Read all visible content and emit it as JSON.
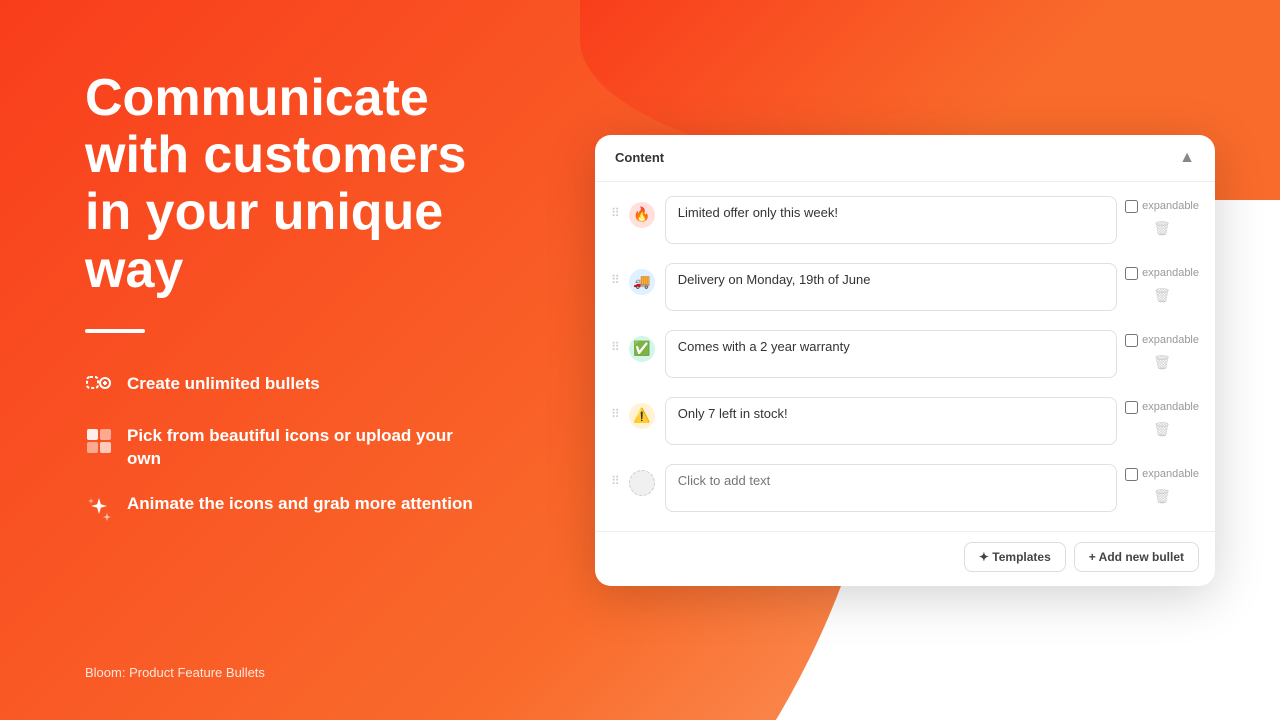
{
  "background": {
    "gradient_start": "#f93d1c",
    "gradient_end": "#fbae7a"
  },
  "left": {
    "headline": "Communicate with customers in your unique way",
    "divider": true,
    "features": [
      {
        "id": "unlimited-bullets",
        "text": "Create unlimited bullets",
        "icon": "bullets-icon"
      },
      {
        "id": "icons",
        "text": "Pick from beautiful icons or upload your own",
        "icon": "icons-icon"
      },
      {
        "id": "animate",
        "text": "Animate the icons and grab more attention",
        "icon": "animate-icon"
      }
    ],
    "brand": "Bloom: Product Feature Bullets"
  },
  "card": {
    "header": {
      "title": "Content",
      "collapse_label": "▲"
    },
    "bullets": [
      {
        "id": "bullet-1",
        "icon_type": "red",
        "icon_emoji": "🔥",
        "text": "Limited offer only this week!",
        "expandable": false,
        "placeholder": false
      },
      {
        "id": "bullet-2",
        "icon_type": "blue",
        "icon_emoji": "🚚",
        "text": "Delivery on Monday, 19th of June",
        "expandable": false,
        "placeholder": false
      },
      {
        "id": "bullet-3",
        "icon_type": "green",
        "icon_emoji": "✅",
        "text": "Comes with a 2 year warranty",
        "expandable": false,
        "placeholder": false
      },
      {
        "id": "bullet-4",
        "icon_type": "orange",
        "icon_emoji": "⚠️",
        "text": "Only 7 left in stock!",
        "expandable": false,
        "placeholder": false
      },
      {
        "id": "bullet-5",
        "icon_type": "empty",
        "icon_emoji": "",
        "text": "",
        "expandable": false,
        "placeholder": true,
        "placeholder_text": "Click to add text"
      }
    ],
    "footer": {
      "templates_label": "✦ Templates",
      "add_bullet_label": "+ Add new bullet"
    }
  }
}
